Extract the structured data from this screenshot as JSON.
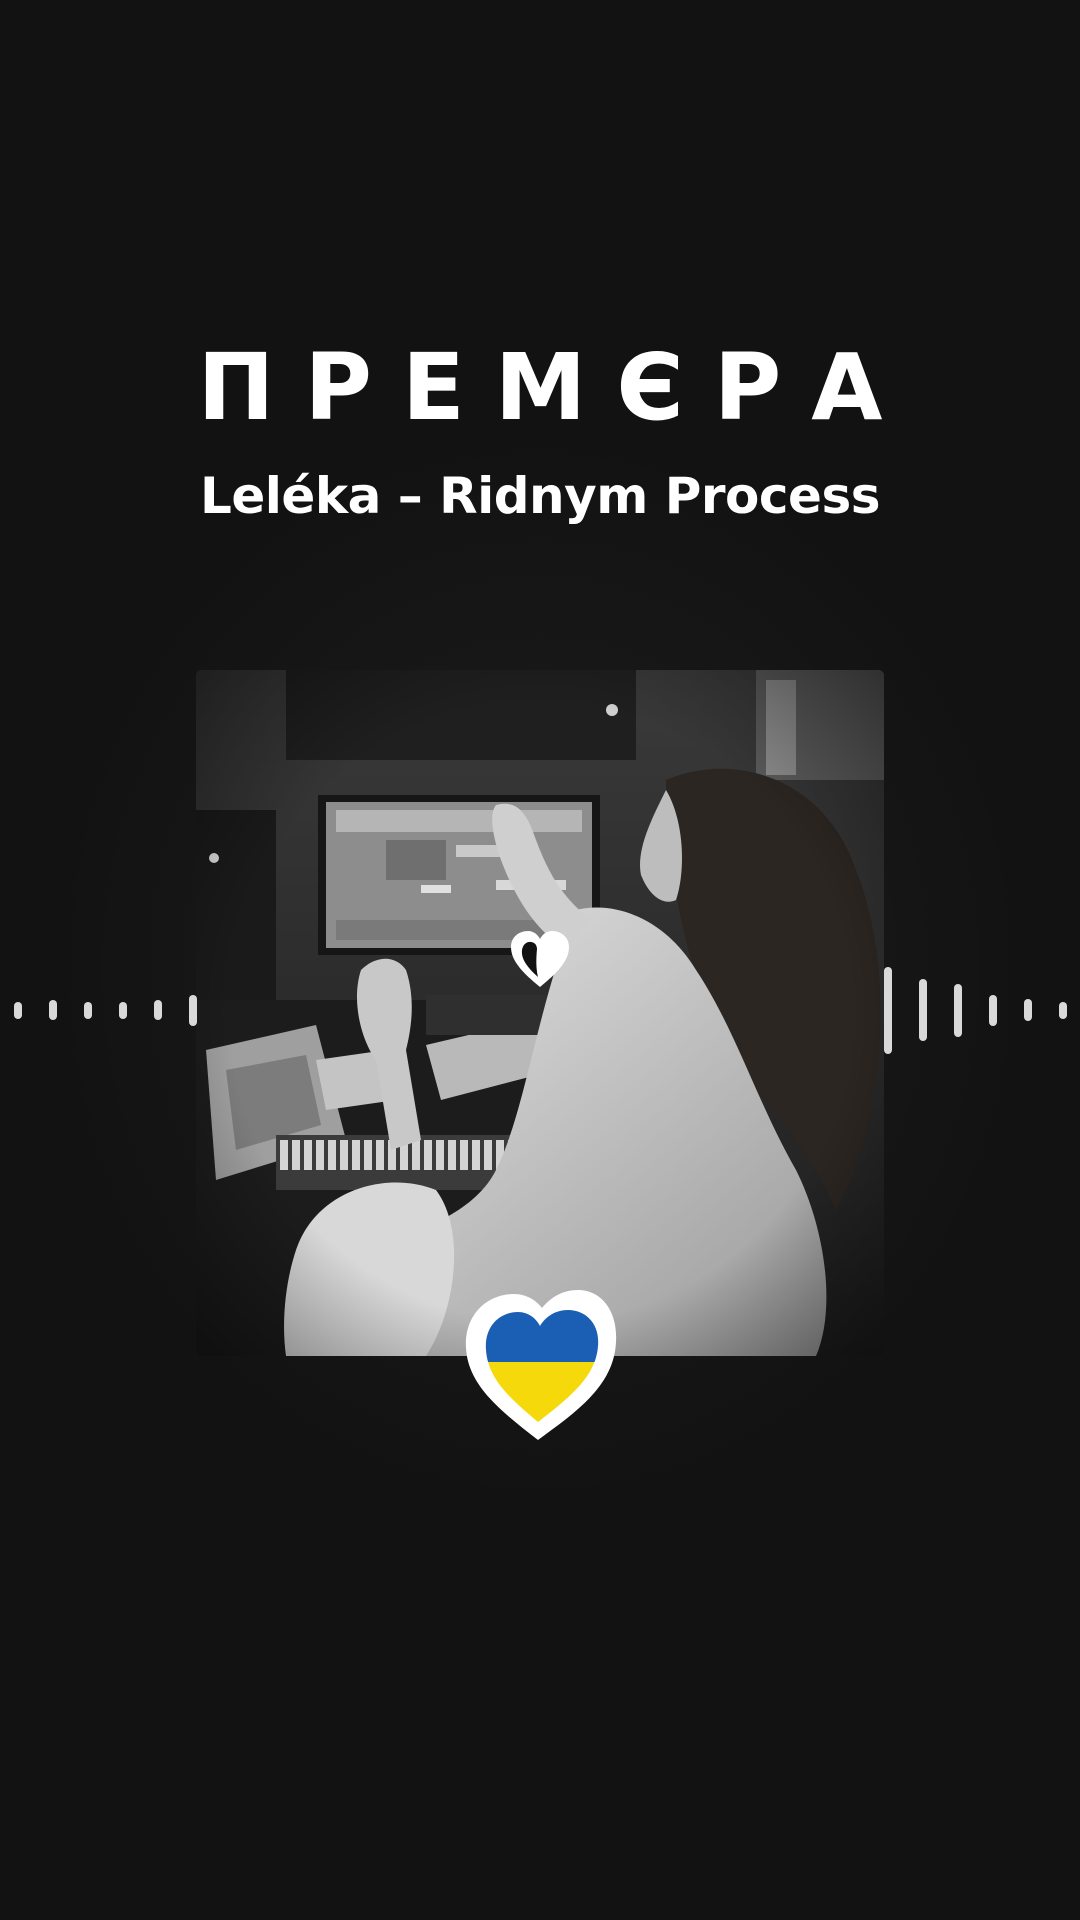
{
  "header": {
    "title": "ПРЕМЄРА",
    "subtitle": "Leléka – Ridnym Process"
  },
  "cover": {
    "image": "studio-photo-black-and-white"
  },
  "icons": {
    "small_heart": "heart-outline-icon",
    "flag_heart": "ukraine-flag-heart-icon"
  },
  "colors": {
    "background": "#121212",
    "text": "#ffffff",
    "flag_blue": "#1a5fb4",
    "flag_yellow": "#f5d90a",
    "wave_bars": "#d9d9d9"
  },
  "waveform": {
    "left_levels": [
      0.12,
      0.14,
      0.12,
      0.12,
      0.14,
      0.22
    ],
    "right_levels": [
      0.62,
      0.44,
      0.38,
      0.22,
      0.16,
      0.12
    ]
  }
}
